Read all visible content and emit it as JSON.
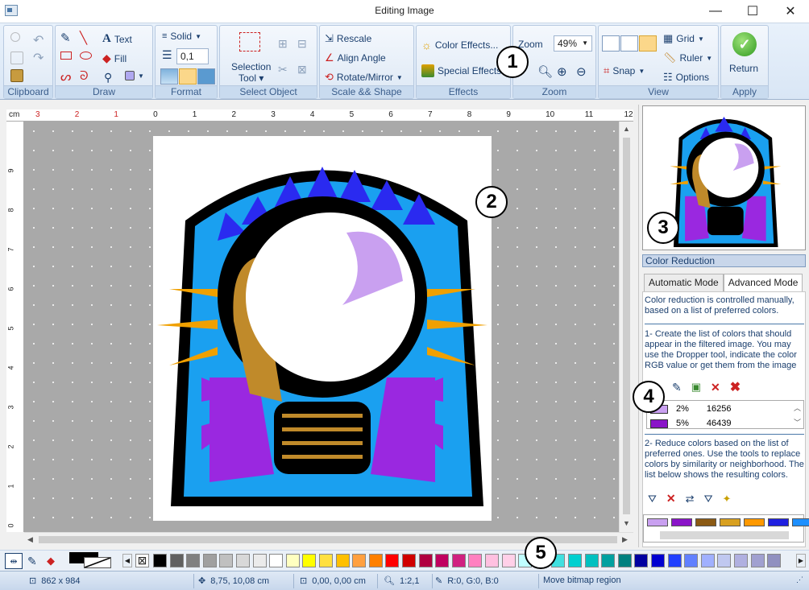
{
  "window": {
    "title": "Editing Image",
    "minimize": "—",
    "maximize": "☐",
    "close": "✕"
  },
  "ribbon": {
    "groups": {
      "clipboard": "Clipboard",
      "draw": "Draw",
      "format": "Format",
      "select_object": "Select Object",
      "scale_shape": "Scale && Shape",
      "effects": "Effects",
      "zoom": "Zoom",
      "view": "View",
      "apply": "Apply"
    },
    "draw": {
      "text": "Text",
      "fill": "Fill"
    },
    "format": {
      "line_style": "Solid",
      "line_width": "0,1"
    },
    "select": {
      "selection_tool_line1": "Selection",
      "selection_tool_line2": "Tool"
    },
    "scale": {
      "rescale": "Rescale",
      "align_angle": "Align Angle",
      "rotate_mirror": "Rotate/Mirror"
    },
    "effects": {
      "color_effects": "Color Effects...",
      "special_effects": "Special Effects"
    },
    "zoom": {
      "label": "Zoom",
      "value": "49%"
    },
    "view": {
      "grid": "Grid",
      "ruler": "Ruler",
      "snap": "Snap",
      "options": "Options"
    },
    "apply": {
      "return": "Return"
    }
  },
  "ruler": {
    "unit": "cm",
    "labels": [
      "3",
      "2",
      "1",
      "0",
      "1",
      "2",
      "3",
      "4",
      "5",
      "6",
      "7",
      "8",
      "9",
      "10",
      "11",
      "12"
    ],
    "vlabels": [
      "9",
      "8",
      "7",
      "6",
      "5",
      "4",
      "3",
      "2",
      "1",
      "0"
    ]
  },
  "panel": {
    "title": "Color Reduction",
    "tabs": [
      "Automatic Mode",
      "Advanced Mode"
    ],
    "intro": "Color reduction is controlled manually, based on a list of preferred colors.",
    "step1": "1- Create the list of colors that should appear in the filtered image. You may use the Dropper tool, indicate the color RGB value or get them from the image",
    "colors": [
      {
        "color": "#c9a0f0",
        "percent": "2%",
        "count": "16256"
      },
      {
        "color": "#8a14c8",
        "percent": "5%",
        "count": "46439"
      }
    ],
    "step2": "2- Reduce colors based on the list of preferred ones. Use the tools to replace colors by similarity or neighborhood. The list below shows the resulting colors.",
    "result_colors": [
      "#c9a0f0",
      "#8a14c8",
      "#8b5a14",
      "#d8a020",
      "#ff9900",
      "#2020e0",
      "#1e90ff"
    ]
  },
  "palette": [
    "#000000",
    "#606060",
    "#808080",
    "#a0a0a0",
    "#c0c0c0",
    "#d8d8d8",
    "#ebebeb",
    "#ffffff",
    "#ffffc0",
    "#ffff00",
    "#ffe040",
    "#ffc000",
    "#ffa040",
    "#ff8000",
    "#ff0000",
    "#d00000",
    "#b00040",
    "#c00060",
    "#d02080",
    "#ff80c0",
    "#ffc0e0",
    "#ffd0e8",
    "#c0ffff",
    "#80ffff",
    "#40e0e0",
    "#00d0d0",
    "#00c0c0",
    "#00a0a0",
    "#008080",
    "#0000a0",
    "#0000d0",
    "#2040ff",
    "#6080ff",
    "#a0b0ff",
    "#c0c8f0",
    "#b0b0e0",
    "#a0a0d0",
    "#9090c0"
  ],
  "status": {
    "size": "862 x 984",
    "position": "8,75, 10,08 cm",
    "selection": "0,00, 0,00 cm",
    "zoom": "1:2,1",
    "color": "R:0, G:0, B:0",
    "message": "Move bitmap region"
  },
  "callouts": [
    "1",
    "2",
    "3",
    "4",
    "5"
  ]
}
